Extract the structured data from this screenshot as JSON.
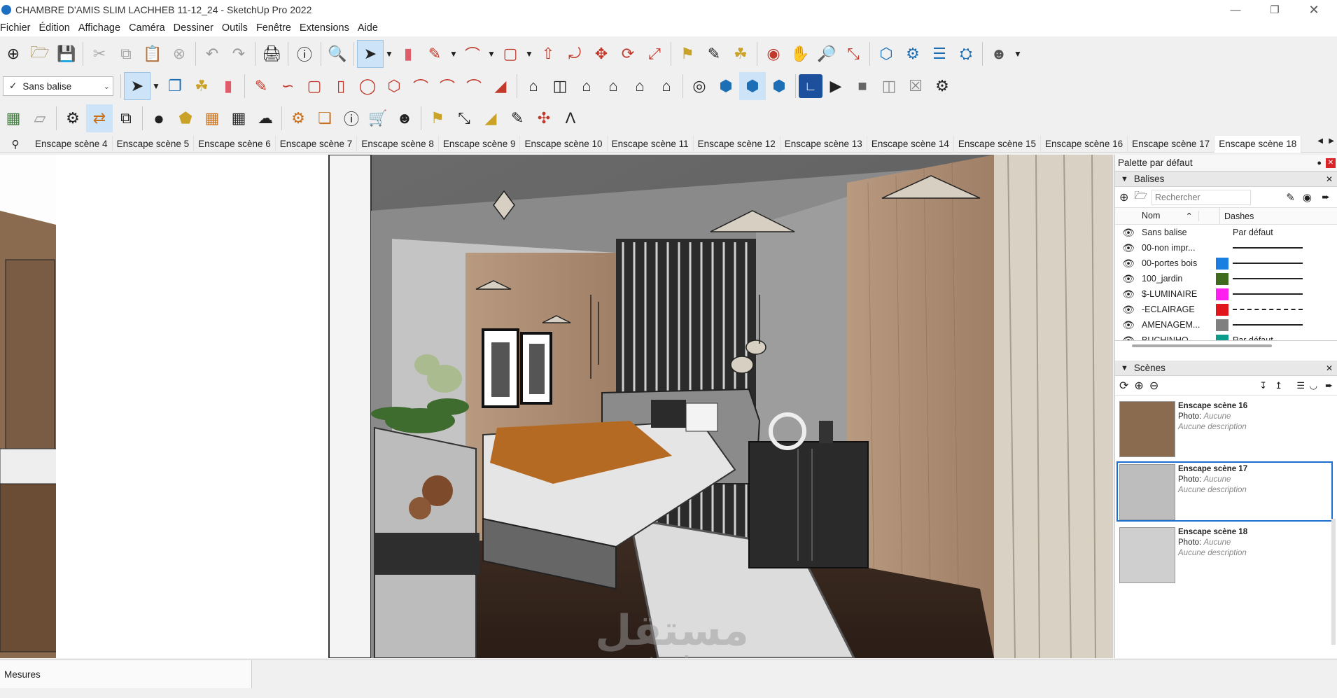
{
  "window": {
    "title": "CHAMBRE D'AMIS SLIM LACHHEB 11-12_24 - SketchUp Pro 2022",
    "minimize_icon": "minimize-icon",
    "maximize_icon": "maximize-icon",
    "close_icon": "close-icon"
  },
  "menu": [
    "Fichier",
    "Édition",
    "Affichage",
    "Caméra",
    "Dessiner",
    "Outils",
    "Fenêtre",
    "Extensions",
    "Aide"
  ],
  "toolbar2": {
    "tag_select": "Sans balise"
  },
  "scene_tabs": [
    "Enscape scène 4",
    "Enscape scène 5",
    "Enscape scène 6",
    "Enscape scène 7",
    "Enscape scène 8",
    "Enscape scène 9",
    "Enscape scène 10",
    "Enscape scène 11",
    "Enscape scène 12",
    "Enscape scène 13",
    "Enscape scène 14",
    "Enscape scène 15",
    "Enscape scène 16",
    "Enscape scène 17",
    "Enscape scène 18"
  ],
  "active_tab": "Enscape scène 18",
  "tray": {
    "title": "Palette par défaut"
  },
  "tags_panel": {
    "title": "Balises",
    "search_placeholder": "Rechercher",
    "col_name": "Nom",
    "col_dashes": "Dashes",
    "rows": [
      {
        "name": "Sans balise",
        "color": "",
        "dashes": "Par défaut"
      },
      {
        "name": "00-non impr...",
        "color": "",
        "dashes": "solid"
      },
      {
        "name": "00-portes bois",
        "color": "#1a7fe0",
        "dashes": "solid"
      },
      {
        "name": "100_jardin",
        "color": "#3e6b1e",
        "dashes": "solid"
      },
      {
        "name": "$-LUMINAIRE",
        "color": "#ff1ff0",
        "dashes": "solid"
      },
      {
        "name": "-ECLAIRAGE",
        "color": "#e0161c",
        "dashes": "dashed"
      },
      {
        "name": "AMENAGEM...",
        "color": "#808080",
        "dashes": "solid"
      },
      {
        "name": "BUCHINHO",
        "color": "#0c9c8c",
        "dashes": "Par défaut"
      }
    ]
  },
  "scenes_panel": {
    "title": "Scènes",
    "items": [
      {
        "name": "Enscape scène 16",
        "photo_label": "Photo:",
        "photo_value": "Aucune",
        "desc": "Aucune description",
        "selected": false
      },
      {
        "name": "Enscape scène 17",
        "photo_label": "Photo:",
        "photo_value": "Aucune",
        "desc": "Aucune description",
        "selected": true
      },
      {
        "name": "Enscape scène 18",
        "photo_label": "Photo:",
        "photo_value": "Aucune",
        "desc": "Aucune description",
        "selected": false
      }
    ]
  },
  "status": {
    "measures_label": "Mesures"
  },
  "watermark": {
    "arabic": "مستقل",
    "latin": "mostaql.com"
  }
}
